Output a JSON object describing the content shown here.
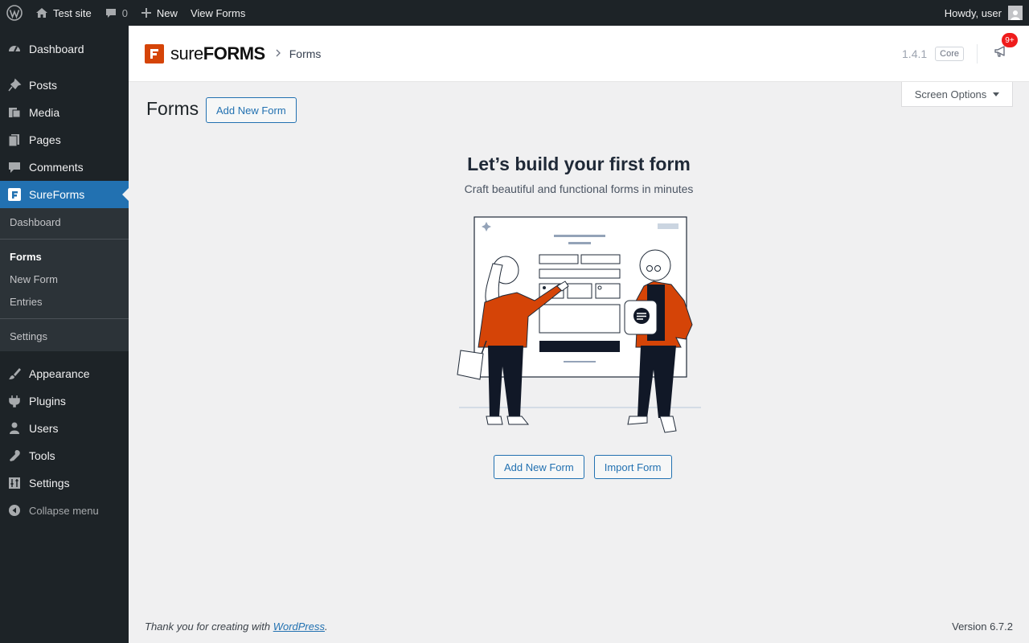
{
  "adminbar": {
    "site_name": "Test site",
    "comments_count": "0",
    "new_label": "New",
    "view_forms_label": "View Forms",
    "greeting": "Howdy, user"
  },
  "sidebar": {
    "items_top": [
      {
        "label": "Dashboard",
        "icon": "dashboard-icon"
      },
      {
        "label": "Posts",
        "icon": "pin-icon"
      },
      {
        "label": "Media",
        "icon": "media-icon"
      },
      {
        "label": "Pages",
        "icon": "pages-icon"
      },
      {
        "label": "Comments",
        "icon": "comment-icon"
      }
    ],
    "active": {
      "label": "SureForms",
      "icon": "sureforms-icon"
    },
    "submenu": [
      "Dashboard",
      "Forms",
      "New Form",
      "Entries",
      "Settings"
    ],
    "items_bottom": [
      {
        "label": "Appearance",
        "icon": "brush-icon"
      },
      {
        "label": "Plugins",
        "icon": "plugin-icon"
      },
      {
        "label": "Users",
        "icon": "user-icon"
      },
      {
        "label": "Tools",
        "icon": "wrench-icon"
      },
      {
        "label": "Settings",
        "icon": "sliders-icon"
      }
    ],
    "collapse_label": "Collapse menu"
  },
  "header": {
    "logo_light": "sure",
    "logo_bold": "FORMS",
    "breadcrumb": "Forms",
    "version": "1.4.1",
    "edition": "Core",
    "notification_count": "9+"
  },
  "screen_options_label": "Screen Options",
  "page": {
    "title": "Forms",
    "add_new_label": "Add New Form"
  },
  "empty_state": {
    "title": "Let’s build your first form",
    "subtitle": "Craft beautiful and functional forms in minutes",
    "add_label": "Add New Form",
    "import_label": "Import Form"
  },
  "footer": {
    "thanks_prefix": "Thank you for creating with ",
    "thanks_link": "WordPress",
    "thanks_suffix": ".",
    "version": "Version 6.7.2"
  },
  "colors": {
    "accent": "#2271b1",
    "brand": "#d54407",
    "sidebar_bg": "#1d2327"
  }
}
